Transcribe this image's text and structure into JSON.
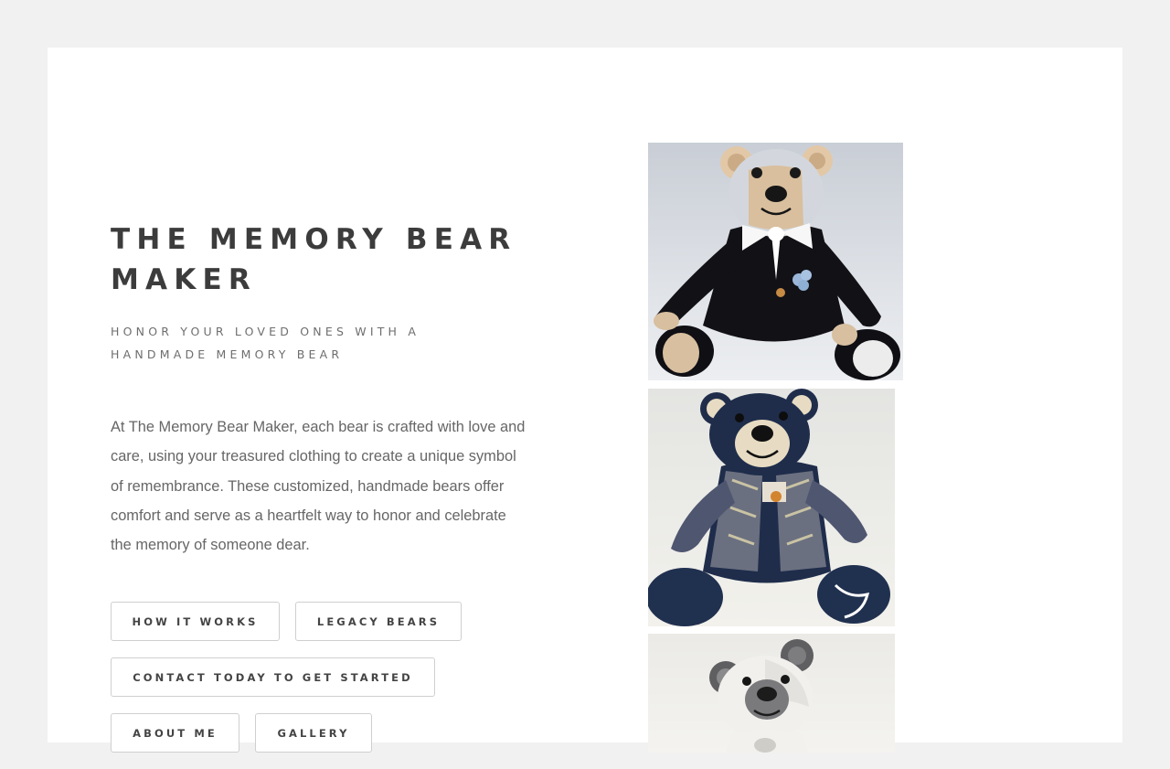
{
  "hero": {
    "title": "THE MEMORY BEAR MAKER",
    "tagline": "HONOR YOUR LOVED ONES WITH A HANDMADE MEMORY BEAR",
    "intro": "At The Memory Bear Maker, each bear is crafted with love and care, using your treasured clothing to create a unique symbol of remembrance. These customized, handmade bears offer comfort and serve as a heartfelt way to honor and celebrate the memory of someone dear."
  },
  "buttons": {
    "how_it_works": "HOW IT WORKS",
    "legacy_bears": "LEGACY BEARS",
    "contact": "CONTACT TODAY TO GET STARTED",
    "about_me": "ABOUT ME",
    "gallery": "GALLERY"
  },
  "photos": [
    {
      "subject": "tuxedo-memory-bear"
    },
    {
      "subject": "denim-jacket-memory-bear"
    },
    {
      "subject": "white-grey-memory-bear"
    }
  ],
  "colors": {
    "page_background": "#f1f1f1",
    "card_background": "#ffffff",
    "heading": "#3c3c3c",
    "body_text": "#666666",
    "button_border": "#cfcfcf"
  }
}
